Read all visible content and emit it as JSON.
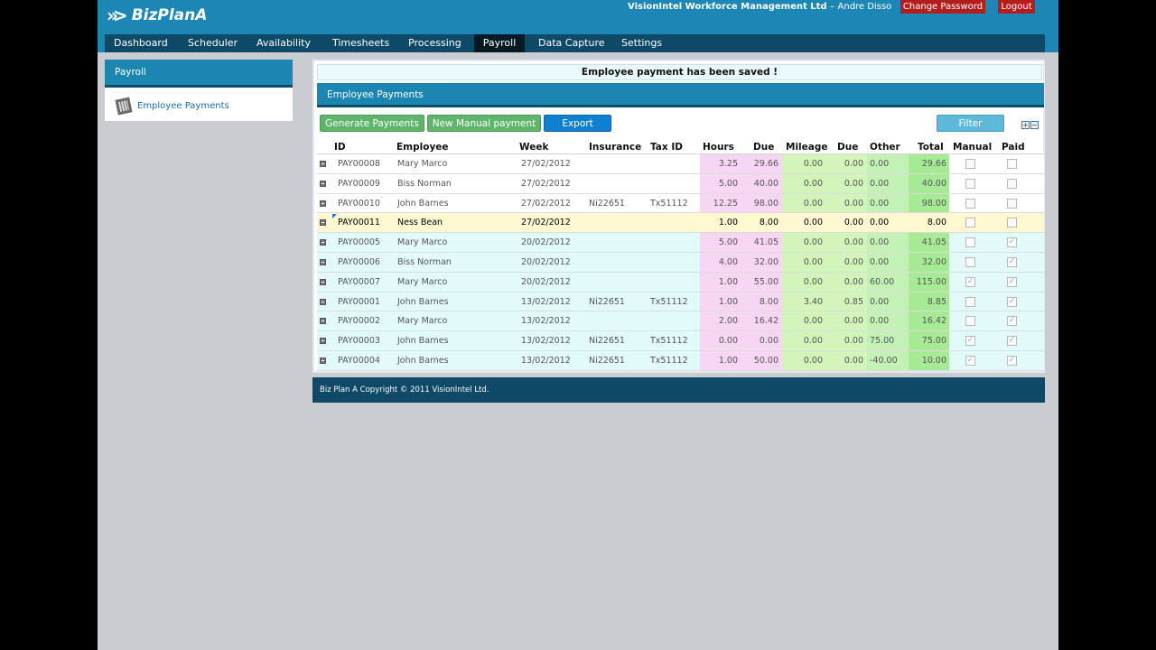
{
  "app": {
    "logo": "BizPlanA",
    "company": "VisionIntel Workforce Management Ltd",
    "separator": "–",
    "user": "Andre Disso",
    "change_password": "Change Password",
    "logout": "Logout"
  },
  "nav": [
    "Dashboard",
    "Scheduler",
    "Availability",
    "Timesheets",
    "Processing",
    "Payroll",
    "Data Capture",
    "Settings"
  ],
  "nav_active": "Payroll",
  "sidebar": {
    "title": "Payroll",
    "item": "Employee Payments"
  },
  "notice": "Employee payment has been saved !",
  "panel": {
    "title": "Employee Payments"
  },
  "toolbar": {
    "generate": "Generate Payments",
    "manual": "New Manual payment",
    "export": "Export",
    "filter": "Filter",
    "expand_all": "+",
    "collapse_all": "−"
  },
  "columns": [
    "ID",
    "Employee",
    "Week",
    "Insurance",
    "Tax ID",
    "Hours",
    "Due",
    "Mileage",
    "Due",
    "Other",
    "Total",
    "Manual",
    "Paid"
  ],
  "rows": [
    {
      "id": "PAY00008",
      "employee": "Mary Marco",
      "week": "27/02/2012",
      "insurance": "",
      "tax": "",
      "hours": "3.25",
      "due": "29.66",
      "mileage": "0.00",
      "due2": "0.00",
      "other": "0.00",
      "total": "29.66",
      "manual": false,
      "paid": false
    },
    {
      "id": "PAY00009",
      "employee": "Biss Norman",
      "week": "27/02/2012",
      "insurance": "",
      "tax": "",
      "hours": "5.00",
      "due": "40.00",
      "mileage": "0.00",
      "due2": "0.00",
      "other": "0.00",
      "total": "40.00",
      "manual": false,
      "paid": false
    },
    {
      "id": "PAY00010",
      "employee": "John Barnes",
      "week": "27/02/2012",
      "insurance": "Ni22651",
      "tax": "Tx51112",
      "hours": "12.25",
      "due": "98.00",
      "mileage": "0.00",
      "due2": "0.00",
      "other": "0.00",
      "total": "98.00",
      "manual": false,
      "paid": false
    },
    {
      "id": "PAY00011",
      "employee": "Ness Bean",
      "week": "27/02/2012",
      "insurance": "",
      "tax": "",
      "hours": "1.00",
      "due": "8.00",
      "mileage": "0.00",
      "due2": "0.00",
      "other": "0.00",
      "total": "8.00",
      "manual": false,
      "paid": false
    },
    {
      "id": "PAY00005",
      "employee": "Mary Marco",
      "week": "20/02/2012",
      "insurance": "",
      "tax": "",
      "hours": "5.00",
      "due": "41.05",
      "mileage": "0.00",
      "due2": "0.00",
      "other": "0.00",
      "total": "41.05",
      "manual": false,
      "paid": true
    },
    {
      "id": "PAY00006",
      "employee": "Biss Norman",
      "week": "20/02/2012",
      "insurance": "",
      "tax": "",
      "hours": "4.00",
      "due": "32.00",
      "mileage": "0.00",
      "due2": "0.00",
      "other": "0.00",
      "total": "32.00",
      "manual": false,
      "paid": true
    },
    {
      "id": "PAY00007",
      "employee": "Mary Marco",
      "week": "20/02/2012",
      "insurance": "",
      "tax": "",
      "hours": "1.00",
      "due": "55.00",
      "mileage": "0.00",
      "due2": "0.00",
      "other": "60.00",
      "total": "115.00",
      "manual": true,
      "paid": true
    },
    {
      "id": "PAY00001",
      "employee": "John Barnes",
      "week": "13/02/2012",
      "insurance": "Ni22651",
      "tax": "Tx51112",
      "hours": "1.00",
      "due": "8.00",
      "mileage": "3.40",
      "due2": "0.85",
      "other": "0.00",
      "total": "8.85",
      "manual": false,
      "paid": true
    },
    {
      "id": "PAY00002",
      "employee": "Mary Marco",
      "week": "13/02/2012",
      "insurance": "",
      "tax": "",
      "hours": "2.00",
      "due": "16.42",
      "mileage": "0.00",
      "due2": "0.00",
      "other": "0.00",
      "total": "16.42",
      "manual": false,
      "paid": true
    },
    {
      "id": "PAY00003",
      "employee": "John Barnes",
      "week": "13/02/2012",
      "insurance": "Ni22651",
      "tax": "Tx51112",
      "hours": "0.00",
      "due": "0.00",
      "mileage": "0.00",
      "due2": "0.00",
      "other": "75.00",
      "total": "75.00",
      "manual": true,
      "paid": true
    },
    {
      "id": "PAY00004",
      "employee": "John Barnes",
      "week": "13/02/2012",
      "insurance": "Ni22651",
      "tax": "Tx51112",
      "hours": "1.00",
      "due": "50.00",
      "mileage": "0.00",
      "due2": "0.00",
      "other": "-40.00",
      "total": "10.00",
      "manual": true,
      "paid": true
    }
  ],
  "selected_row": 3,
  "colors": {
    "header_blue": "#1c87b4",
    "nav_dark": "#0e4a67",
    "hours_pink": "#f7d6f4",
    "mileage_green": "#d3f5b9",
    "other_green": "#c4f1b5",
    "total_green": "#a6ea95",
    "paid_row": "#e2fbfa",
    "selected_row": "#fdf8d2",
    "danger_red": "#b51c1c"
  },
  "footer": "Biz Plan A Copyright © 2011 VisionIntel Ltd."
}
